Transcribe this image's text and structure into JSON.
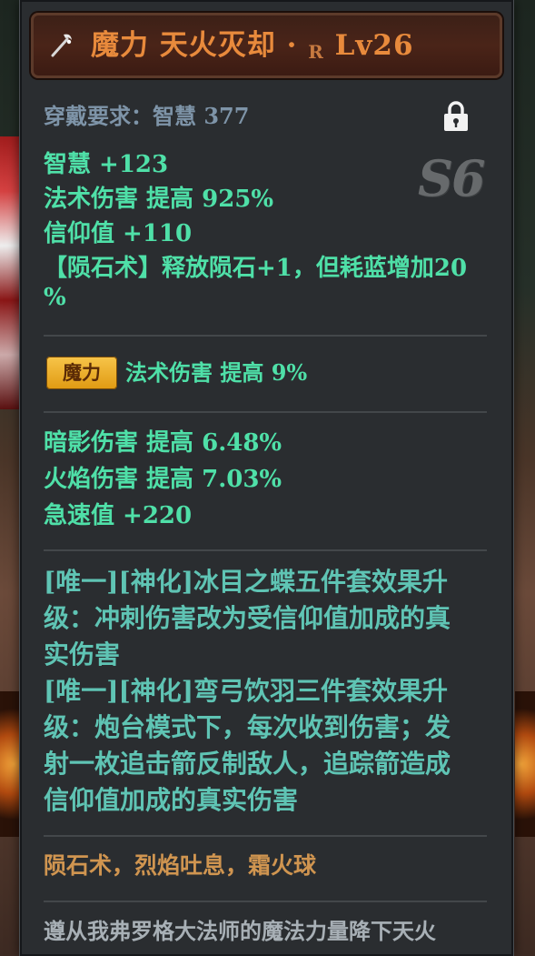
{
  "header": {
    "title": "魔力  天火灭却 ·",
    "rank": "R",
    "level": "Lv26"
  },
  "requirement": "穿戴要求：智慧  377",
  "season_mark": "S6",
  "base_stats": [
    "智慧  +123",
    "法术伤害  提高  925%",
    "信仰值  +110",
    "【陨石术】释放陨石+1，但耗蓝增加20",
    "%"
  ],
  "enchant": {
    "badge": "魔力",
    "text": "法术伤害  提高  9%"
  },
  "extra_stats": [
    "暗影伤害  提高  6.48%",
    "火焰伤害  提高  7.03%",
    "急速值  +220"
  ],
  "set_effects": [
    "[唯一][神化]冰目之蝶五件套效果升",
    "级：冲刺伤害改为受信仰值加成的真",
    "实伤害",
    "[唯一][神化]弯弓饮羽三件套效果升",
    "级：炮台模式下，每次收到伤害；发",
    "射一枚追击箭反制敌人，追踪箭造成",
    "信仰值加成的真实伤害"
  ],
  "skills": "陨石术，烈焰吐息，霜火球",
  "lore": "遵从我弗罗格大法师的魔法力量降下天火",
  "icons": {
    "weapon": "wand-icon",
    "lock": "lock-icon"
  },
  "colors": {
    "title": "#e88a3c",
    "stat_green": "#4fe0a8",
    "set_teal": "#5fc4b4",
    "skills_orange": "#d09550",
    "badge_gold": "#f0b030"
  }
}
